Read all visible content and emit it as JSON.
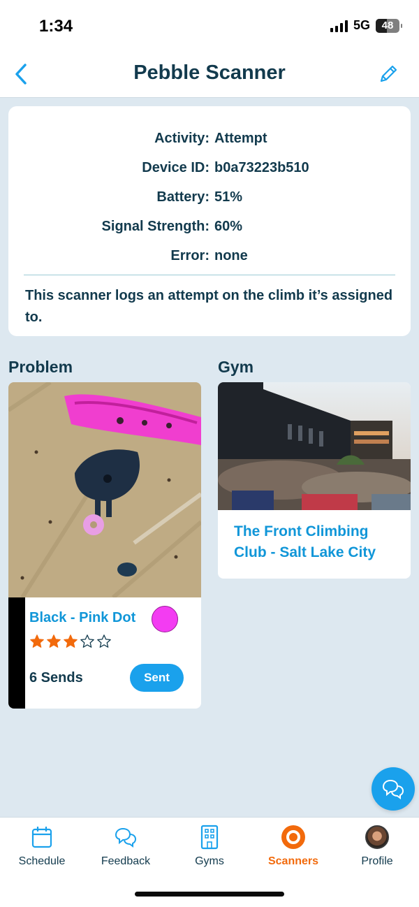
{
  "status_bar": {
    "time": "1:34",
    "network": "5G",
    "battery": "48"
  },
  "header": {
    "title": "Pebble Scanner"
  },
  "info": {
    "rows": [
      {
        "label": "Activity:",
        "value": "Attempt"
      },
      {
        "label": "Device ID:",
        "value": "b0a73223b510"
      },
      {
        "label": "Battery:",
        "value": "51%"
      },
      {
        "label": "Signal Strength:",
        "value": "60%"
      },
      {
        "label": "Error:",
        "value": "none"
      }
    ],
    "description": "This scanner logs an attempt on the climb it’s assigned to."
  },
  "problem": {
    "section_title": "Problem",
    "name": "Black - Pink Dot",
    "dot_color": "#f33cf2",
    "strip_color": "#000000",
    "rating": 3,
    "rating_max": 5,
    "sends": "6 Sends",
    "sent_label": "Sent"
  },
  "gym": {
    "section_title": "Gym",
    "name": "The Front Climbing Club - Salt Lake City"
  },
  "tabs": [
    {
      "label": "Schedule",
      "icon": "calendar-icon"
    },
    {
      "label": "Feedback",
      "icon": "chat-bubbles-icon"
    },
    {
      "label": "Gyms",
      "icon": "building-icon"
    },
    {
      "label": "Scanners",
      "icon": "scanner-icon",
      "active": true
    },
    {
      "label": "Profile",
      "icon": "avatar"
    }
  ],
  "colors": {
    "accent": "#1aa1ec",
    "active_tab": "#f26a0c",
    "text": "#123a4d"
  }
}
